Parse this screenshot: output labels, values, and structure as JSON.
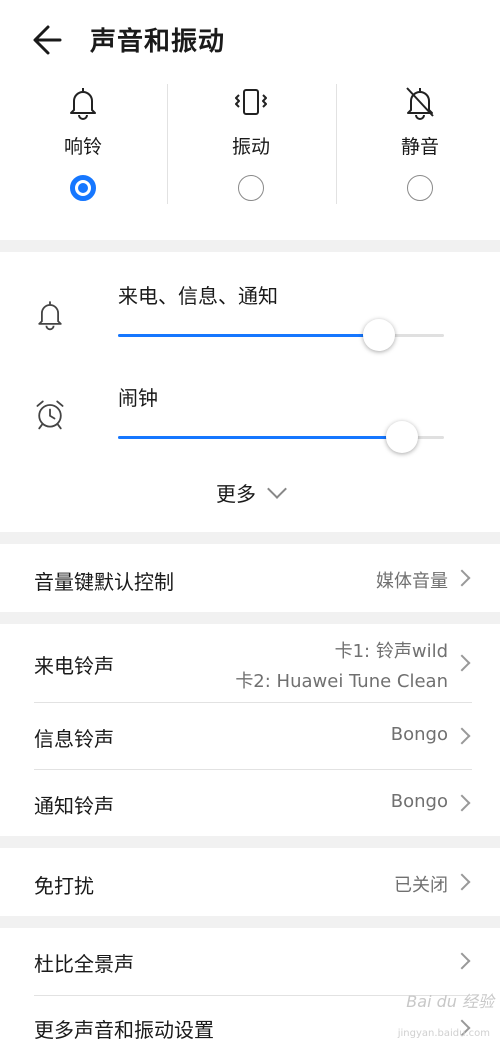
{
  "header": {
    "title": "声音和振动"
  },
  "modes": [
    {
      "label": "响铃",
      "icon": "bell-icon",
      "selected": true
    },
    {
      "label": "振动",
      "icon": "vibrate-icon",
      "selected": false
    },
    {
      "label": "静音",
      "icon": "bell-off-icon",
      "selected": false
    }
  ],
  "volume": {
    "ringtone": {
      "label": "来电、信息、通知",
      "level": 0.8
    },
    "alarm": {
      "label": "闹钟",
      "level": 0.87
    },
    "more_label": "更多"
  },
  "volume_key": {
    "label": "音量键默认控制",
    "value": "媒体音量"
  },
  "tones": {
    "call": {
      "label": "来电铃声",
      "value_line1": "卡1: 铃声wild",
      "value_line2": "卡2: Huawei Tune Clean"
    },
    "message": {
      "label": "信息铃声",
      "value": "Bongo"
    },
    "notification": {
      "label": "通知铃声",
      "value": "Bongo"
    }
  },
  "dnd": {
    "label": "免打扰",
    "value": "已关闭"
  },
  "dolby": {
    "label": "杜比全景声"
  },
  "more_settings": {
    "label": "更多声音和振动设置"
  },
  "watermark": {
    "brand": "Bai du 经验",
    "url": "jingyan.baidu.com"
  },
  "colors": {
    "accent": "#1677ff",
    "background": "#f1f1f1",
    "card": "#ffffff"
  }
}
